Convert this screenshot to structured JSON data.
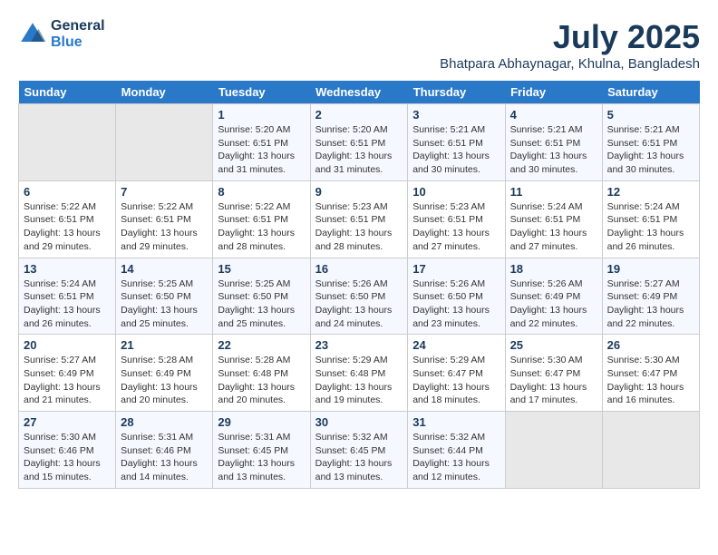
{
  "logo": {
    "line1": "General",
    "line2": "Blue"
  },
  "title": {
    "month_year": "July 2025",
    "location": "Bhatpara Abhaynagar, Khulna, Bangladesh"
  },
  "headers": [
    "Sunday",
    "Monday",
    "Tuesday",
    "Wednesday",
    "Thursday",
    "Friday",
    "Saturday"
  ],
  "weeks": [
    [
      {
        "day": "",
        "info": ""
      },
      {
        "day": "",
        "info": ""
      },
      {
        "day": "1",
        "info": "Sunrise: 5:20 AM\nSunset: 6:51 PM\nDaylight: 13 hours\nand 31 minutes."
      },
      {
        "day": "2",
        "info": "Sunrise: 5:20 AM\nSunset: 6:51 PM\nDaylight: 13 hours\nand 31 minutes."
      },
      {
        "day": "3",
        "info": "Sunrise: 5:21 AM\nSunset: 6:51 PM\nDaylight: 13 hours\nand 30 minutes."
      },
      {
        "day": "4",
        "info": "Sunrise: 5:21 AM\nSunset: 6:51 PM\nDaylight: 13 hours\nand 30 minutes."
      },
      {
        "day": "5",
        "info": "Sunrise: 5:21 AM\nSunset: 6:51 PM\nDaylight: 13 hours\nand 30 minutes."
      }
    ],
    [
      {
        "day": "6",
        "info": "Sunrise: 5:22 AM\nSunset: 6:51 PM\nDaylight: 13 hours\nand 29 minutes."
      },
      {
        "day": "7",
        "info": "Sunrise: 5:22 AM\nSunset: 6:51 PM\nDaylight: 13 hours\nand 29 minutes."
      },
      {
        "day": "8",
        "info": "Sunrise: 5:22 AM\nSunset: 6:51 PM\nDaylight: 13 hours\nand 28 minutes."
      },
      {
        "day": "9",
        "info": "Sunrise: 5:23 AM\nSunset: 6:51 PM\nDaylight: 13 hours\nand 28 minutes."
      },
      {
        "day": "10",
        "info": "Sunrise: 5:23 AM\nSunset: 6:51 PM\nDaylight: 13 hours\nand 27 minutes."
      },
      {
        "day": "11",
        "info": "Sunrise: 5:24 AM\nSunset: 6:51 PM\nDaylight: 13 hours\nand 27 minutes."
      },
      {
        "day": "12",
        "info": "Sunrise: 5:24 AM\nSunset: 6:51 PM\nDaylight: 13 hours\nand 26 minutes."
      }
    ],
    [
      {
        "day": "13",
        "info": "Sunrise: 5:24 AM\nSunset: 6:51 PM\nDaylight: 13 hours\nand 26 minutes."
      },
      {
        "day": "14",
        "info": "Sunrise: 5:25 AM\nSunset: 6:50 PM\nDaylight: 13 hours\nand 25 minutes."
      },
      {
        "day": "15",
        "info": "Sunrise: 5:25 AM\nSunset: 6:50 PM\nDaylight: 13 hours\nand 25 minutes."
      },
      {
        "day": "16",
        "info": "Sunrise: 5:26 AM\nSunset: 6:50 PM\nDaylight: 13 hours\nand 24 minutes."
      },
      {
        "day": "17",
        "info": "Sunrise: 5:26 AM\nSunset: 6:50 PM\nDaylight: 13 hours\nand 23 minutes."
      },
      {
        "day": "18",
        "info": "Sunrise: 5:26 AM\nSunset: 6:49 PM\nDaylight: 13 hours\nand 22 minutes."
      },
      {
        "day": "19",
        "info": "Sunrise: 5:27 AM\nSunset: 6:49 PM\nDaylight: 13 hours\nand 22 minutes."
      }
    ],
    [
      {
        "day": "20",
        "info": "Sunrise: 5:27 AM\nSunset: 6:49 PM\nDaylight: 13 hours\nand 21 minutes."
      },
      {
        "day": "21",
        "info": "Sunrise: 5:28 AM\nSunset: 6:49 PM\nDaylight: 13 hours\nand 20 minutes."
      },
      {
        "day": "22",
        "info": "Sunrise: 5:28 AM\nSunset: 6:48 PM\nDaylight: 13 hours\nand 20 minutes."
      },
      {
        "day": "23",
        "info": "Sunrise: 5:29 AM\nSunset: 6:48 PM\nDaylight: 13 hours\nand 19 minutes."
      },
      {
        "day": "24",
        "info": "Sunrise: 5:29 AM\nSunset: 6:47 PM\nDaylight: 13 hours\nand 18 minutes."
      },
      {
        "day": "25",
        "info": "Sunrise: 5:30 AM\nSunset: 6:47 PM\nDaylight: 13 hours\nand 17 minutes."
      },
      {
        "day": "26",
        "info": "Sunrise: 5:30 AM\nSunset: 6:47 PM\nDaylight: 13 hours\nand 16 minutes."
      }
    ],
    [
      {
        "day": "27",
        "info": "Sunrise: 5:30 AM\nSunset: 6:46 PM\nDaylight: 13 hours\nand 15 minutes."
      },
      {
        "day": "28",
        "info": "Sunrise: 5:31 AM\nSunset: 6:46 PM\nDaylight: 13 hours\nand 14 minutes."
      },
      {
        "day": "29",
        "info": "Sunrise: 5:31 AM\nSunset: 6:45 PM\nDaylight: 13 hours\nand 13 minutes."
      },
      {
        "day": "30",
        "info": "Sunrise: 5:32 AM\nSunset: 6:45 PM\nDaylight: 13 hours\nand 13 minutes."
      },
      {
        "day": "31",
        "info": "Sunrise: 5:32 AM\nSunset: 6:44 PM\nDaylight: 13 hours\nand 12 minutes."
      },
      {
        "day": "",
        "info": ""
      },
      {
        "day": "",
        "info": ""
      }
    ]
  ]
}
